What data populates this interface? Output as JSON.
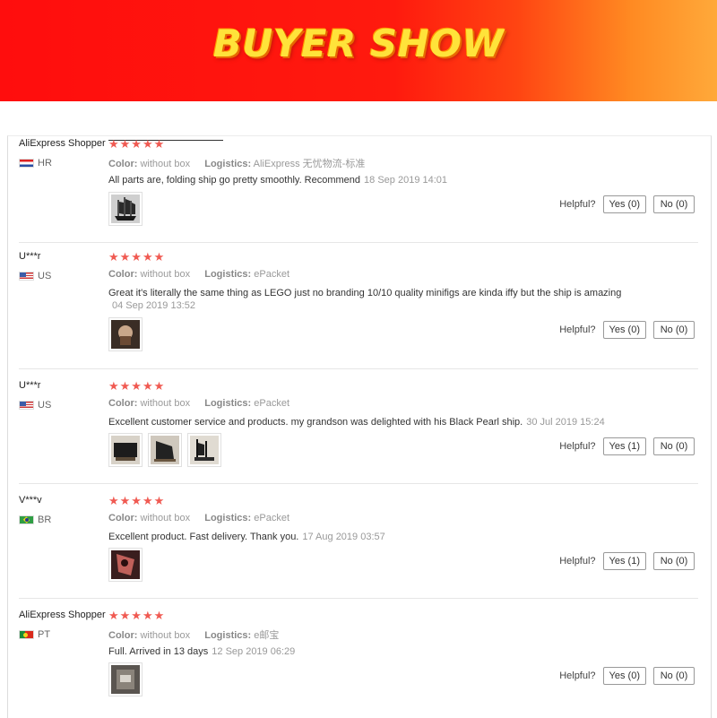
{
  "banner": {
    "title": "BUYER SHOW"
  },
  "labels": {
    "color": "Color:",
    "logistics": "Logistics:",
    "helpful": "Helpful?"
  },
  "reviews": [
    {
      "user": "AliExpress Shopper",
      "country": "HR",
      "stars": "★★★★★",
      "color": "without box",
      "logistics": "AliExpress 无忧物流-标准",
      "text": "All parts are, folding ship go pretty smoothly. Recommend",
      "date": "18 Sep 2019 14:01",
      "yes": "Yes (0)",
      "no": "No (0)"
    },
    {
      "user": "U***r",
      "country": "US",
      "stars": "★★★★★",
      "color": "without box",
      "logistics": "ePacket",
      "text": "Great it's literally the same thing as LEGO just no branding 10/10 quality minifigs are kinda iffy but the ship is amazing",
      "date": "04 Sep 2019 13:52",
      "yes": "Yes (0)",
      "no": "No (0)"
    },
    {
      "user": "U***r",
      "country": "US",
      "stars": "★★★★★",
      "color": "without box",
      "logistics": "ePacket",
      "text": "Excellent customer service and products. my grandson was delighted with his Black Pearl ship.",
      "date": "30 Jul 2019 15:24",
      "yes": "Yes (1)",
      "no": "No (0)"
    },
    {
      "user": "V***v",
      "country": "BR",
      "stars": "★★★★★",
      "color": "without box",
      "logistics": "ePacket",
      "text": "Excellent product. Fast delivery. Thank you.",
      "date": "17 Aug 2019 03:57",
      "yes": "Yes (1)",
      "no": "No (0)"
    },
    {
      "user": "AliExpress Shopper",
      "country": "PT",
      "stars": "★★★★★",
      "color": "without box",
      "logistics": "e邮宝",
      "text": "Full. Arrived in 13 days",
      "date": "12 Sep 2019 06:29",
      "yes": "Yes (0)",
      "no": "No (0)"
    }
  ]
}
